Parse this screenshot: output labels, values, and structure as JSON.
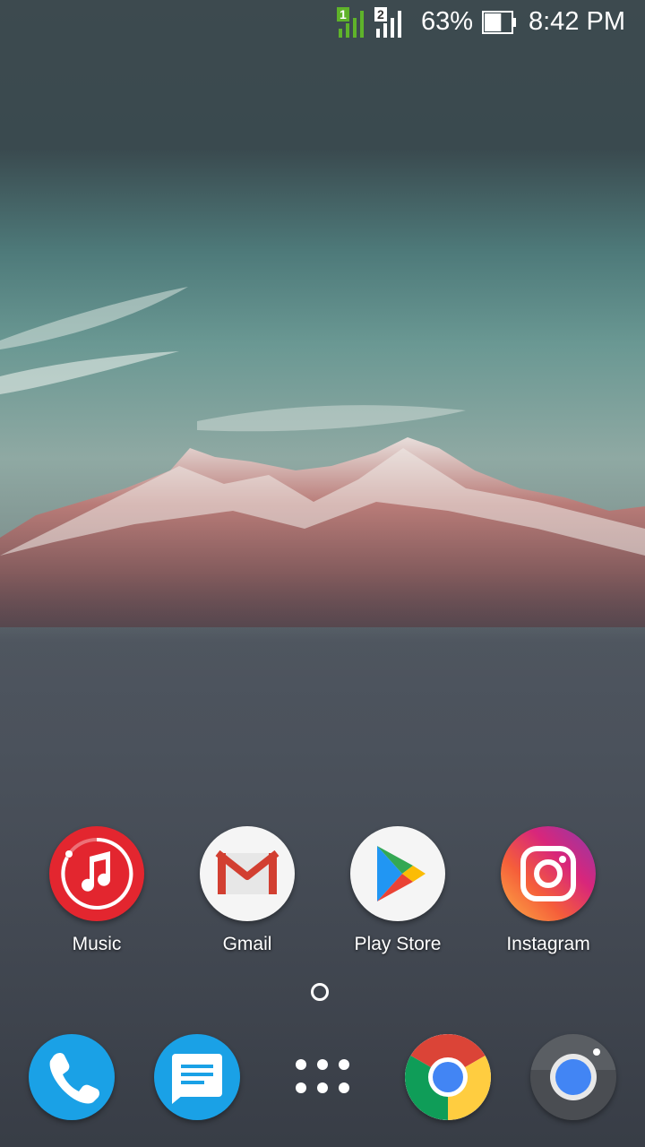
{
  "status_bar": {
    "sim1_badge": "1",
    "sim2_badge": "2",
    "battery_percent": "63%",
    "time": "8:42 PM",
    "battery_level": 0.63
  },
  "home_apps": [
    {
      "label": "Music",
      "icon": "music-icon"
    },
    {
      "label": "Gmail",
      "icon": "gmail-icon"
    },
    {
      "label": "Play Store",
      "icon": "play-store-icon"
    },
    {
      "label": "Instagram",
      "icon": "instagram-icon"
    }
  ],
  "page_indicator": {
    "current_page": 1
  },
  "dock": [
    {
      "icon": "phone-icon"
    },
    {
      "icon": "messages-icon"
    },
    {
      "icon": "all-apps-icon"
    },
    {
      "icon": "chrome-icon"
    },
    {
      "icon": "camera-icon"
    }
  ],
  "colors": {
    "music": "#e3262f",
    "gmail_red": "#d23f31",
    "phone": "#1aa1e6",
    "messages": "#1aa1e6",
    "camera": "#4a4d52"
  }
}
